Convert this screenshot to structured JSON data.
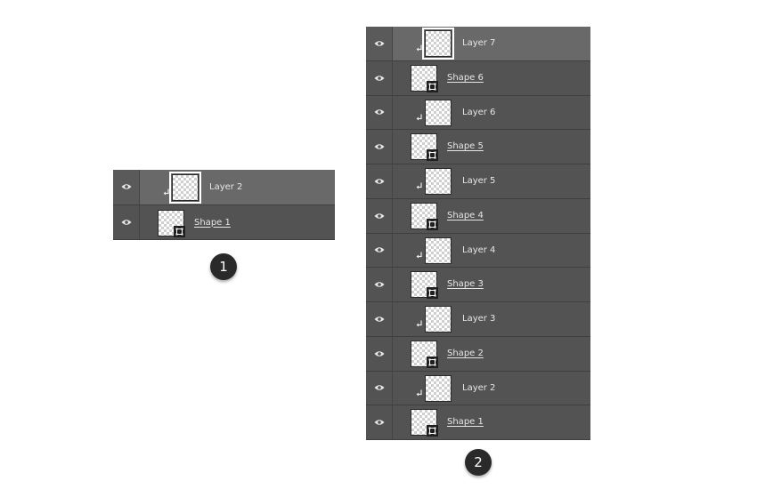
{
  "colors": {
    "panel_bg": "#535353",
    "selected_row_bg": "#696969",
    "label_text": "#e6e6e6",
    "badge_bg": "#2a2a2a"
  },
  "panel1": {
    "badge": "1",
    "layers": [
      {
        "name": "Layer 2",
        "type": "clipped-layer",
        "selected": true
      },
      {
        "name": "Shape 1",
        "type": "shape",
        "selected": false
      }
    ]
  },
  "panel2": {
    "badge": "2",
    "layers": [
      {
        "name": "Layer 7",
        "type": "clipped-layer",
        "selected": true
      },
      {
        "name": "Shape 6",
        "type": "shape",
        "selected": false
      },
      {
        "name": "Layer 6",
        "type": "clipped-layer",
        "selected": false
      },
      {
        "name": "Shape 5",
        "type": "shape",
        "selected": false
      },
      {
        "name": "Layer 5",
        "type": "clipped-layer",
        "selected": false
      },
      {
        "name": "Shape 4",
        "type": "shape",
        "selected": false
      },
      {
        "name": "Layer 4",
        "type": "clipped-layer",
        "selected": false
      },
      {
        "name": "Shape 3",
        "type": "shape",
        "selected": false
      },
      {
        "name": "Layer 3",
        "type": "clipped-layer",
        "selected": false
      },
      {
        "name": "Shape 2",
        "type": "shape",
        "selected": false
      },
      {
        "name": "Layer 2",
        "type": "clipped-layer",
        "selected": false
      },
      {
        "name": "Shape 1",
        "type": "shape",
        "selected": false
      }
    ]
  }
}
